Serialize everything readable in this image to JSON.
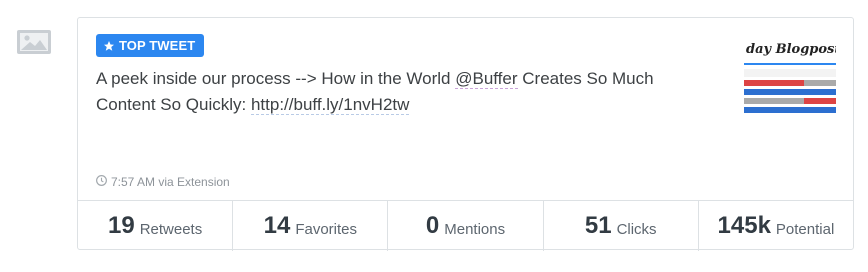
{
  "icons": {
    "side": "image-placeholder-icon",
    "badge": "star-icon",
    "meta": "clock-icon"
  },
  "colors": {
    "accent": "#2c87f0",
    "border": "#dde1e4",
    "muted": "#8d9399"
  },
  "post": {
    "badge_label": "TOP TWEET",
    "text_before": "A peek inside our process --> How in the World ",
    "mention": "@Buffer",
    "text_middle": " Creates So Much Content So Quickly: ",
    "link": "http://buff.ly/1nvH2tw",
    "thumbnail_text": "day Blogpost P",
    "timestamp": "7:57 AM via Extension"
  },
  "stats": [
    {
      "value": "19",
      "label": "Retweets"
    },
    {
      "value": "14",
      "label": "Favorites"
    },
    {
      "value": "0",
      "label": "Mentions"
    },
    {
      "value": "51",
      "label": "Clicks"
    },
    {
      "value": "145k",
      "label": "Potential"
    }
  ]
}
